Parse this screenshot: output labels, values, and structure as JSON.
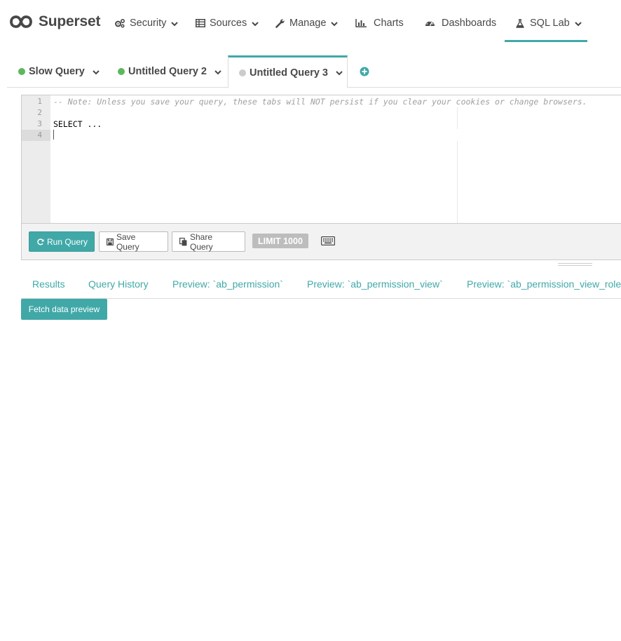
{
  "app": {
    "brand": "Superset"
  },
  "nav": {
    "security": "Security",
    "sources": "Sources",
    "manage": "Manage",
    "charts": "Charts",
    "dashboards": "Dashboards",
    "sqllab": "SQL Lab"
  },
  "query_tabs": [
    {
      "label": "Slow Query",
      "status_color": "#5cb85c"
    },
    {
      "label": "Untitled Query 2",
      "status_color": "#5cb85c"
    },
    {
      "label": "Untitled Query 3",
      "status_color": "#cccccc"
    }
  ],
  "editor": {
    "line_numbers": [
      "1",
      "2",
      "3",
      "4"
    ],
    "lines": [
      "-- Note: Unless you save your query, these tabs will NOT persist if you clear your cookies or change browsers.",
      "",
      "SELECT ...",
      ""
    ]
  },
  "toolbar": {
    "run": "Run Query",
    "save": "Save Query",
    "share": "Share Query",
    "limit": "LIMIT 1000"
  },
  "result_tabs": [
    "Results",
    "Query History",
    "Preview: `ab_permission`",
    "Preview: `ab_permission_view`",
    "Preview: `ab_permission_view_role`"
  ],
  "fetch_preview": "Fetch data preview",
  "colors": {
    "accent": "#41a8a8",
    "text": "#484848"
  }
}
